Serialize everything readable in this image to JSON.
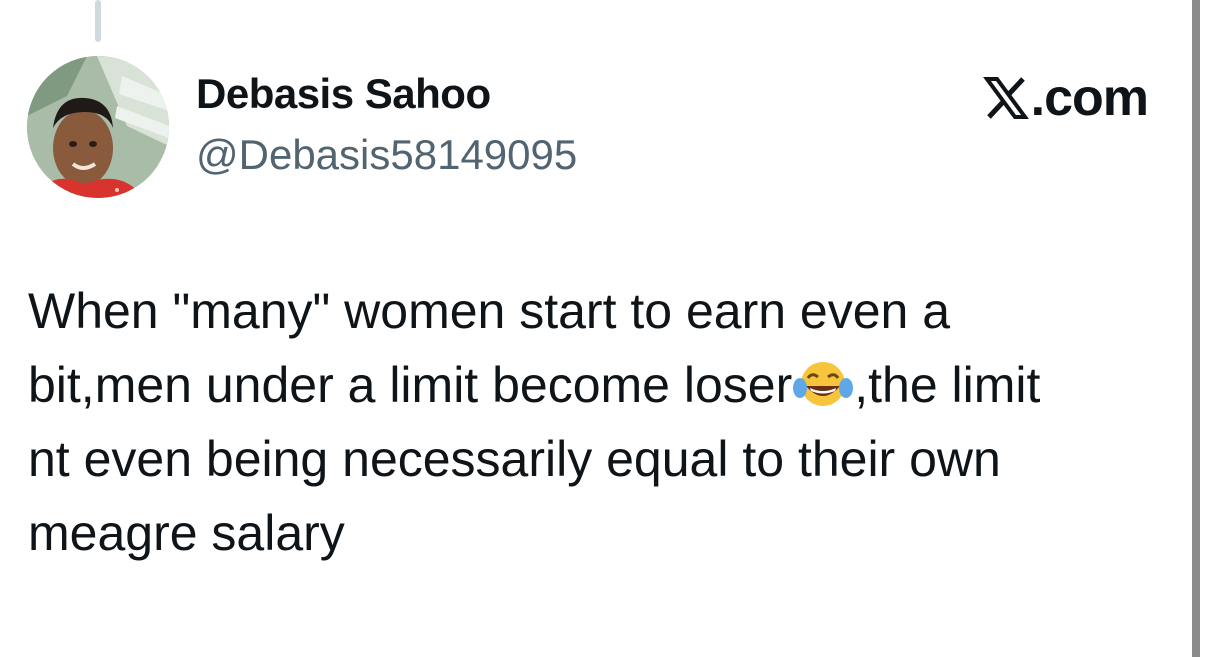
{
  "author": {
    "display_name": "Debasis Sahoo",
    "handle": "@Debasis58149095",
    "avatar_icon": "profile-photo"
  },
  "source": {
    "label": ".com",
    "logo_icon": "x-logo-icon"
  },
  "tweet": {
    "text_before_emoji": "When \"many\" women start to earn even a\nbit,men under a limit become loser",
    "emoji_icon": "face-with-tears-of-joy-icon",
    "text_after_emoji": ",the limit\nnt even being necessarily equal to their own\nmeagre salary"
  },
  "meta": {
    "timestamp": ""
  },
  "colors": {
    "text": "#0f1419",
    "secondary_text": "#536471",
    "thread_line": "#cfd9de"
  }
}
